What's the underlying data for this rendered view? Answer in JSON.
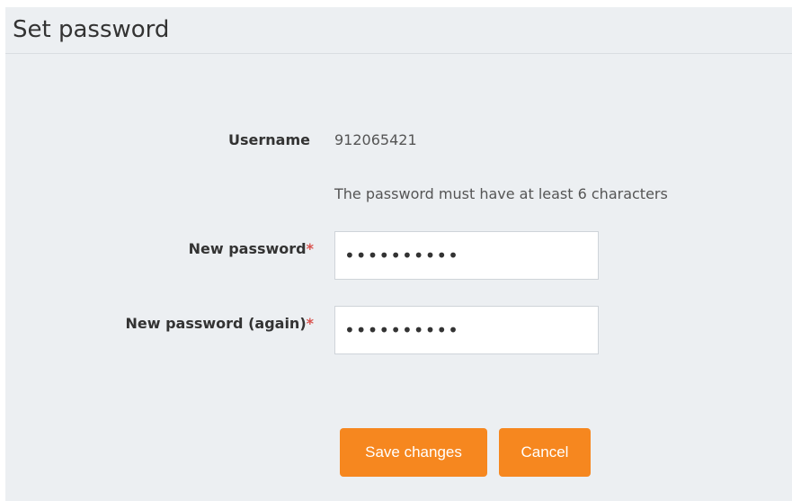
{
  "header": {
    "title": "Set password"
  },
  "form": {
    "username_label": "Username",
    "username_value": "912065421",
    "password_hint": "The password must have at least 6 characters",
    "new_password_label": "New password",
    "new_password_value": "••••••••••",
    "new_password_again_label": "New password (again)",
    "new_password_again_value": "••••••••••",
    "required_marker": "*"
  },
  "actions": {
    "save_label": "Save changes",
    "cancel_label": "Cancel"
  },
  "colors": {
    "accent": "#f6871f",
    "required": "#d9534f",
    "panel_background": "#eceff2"
  }
}
